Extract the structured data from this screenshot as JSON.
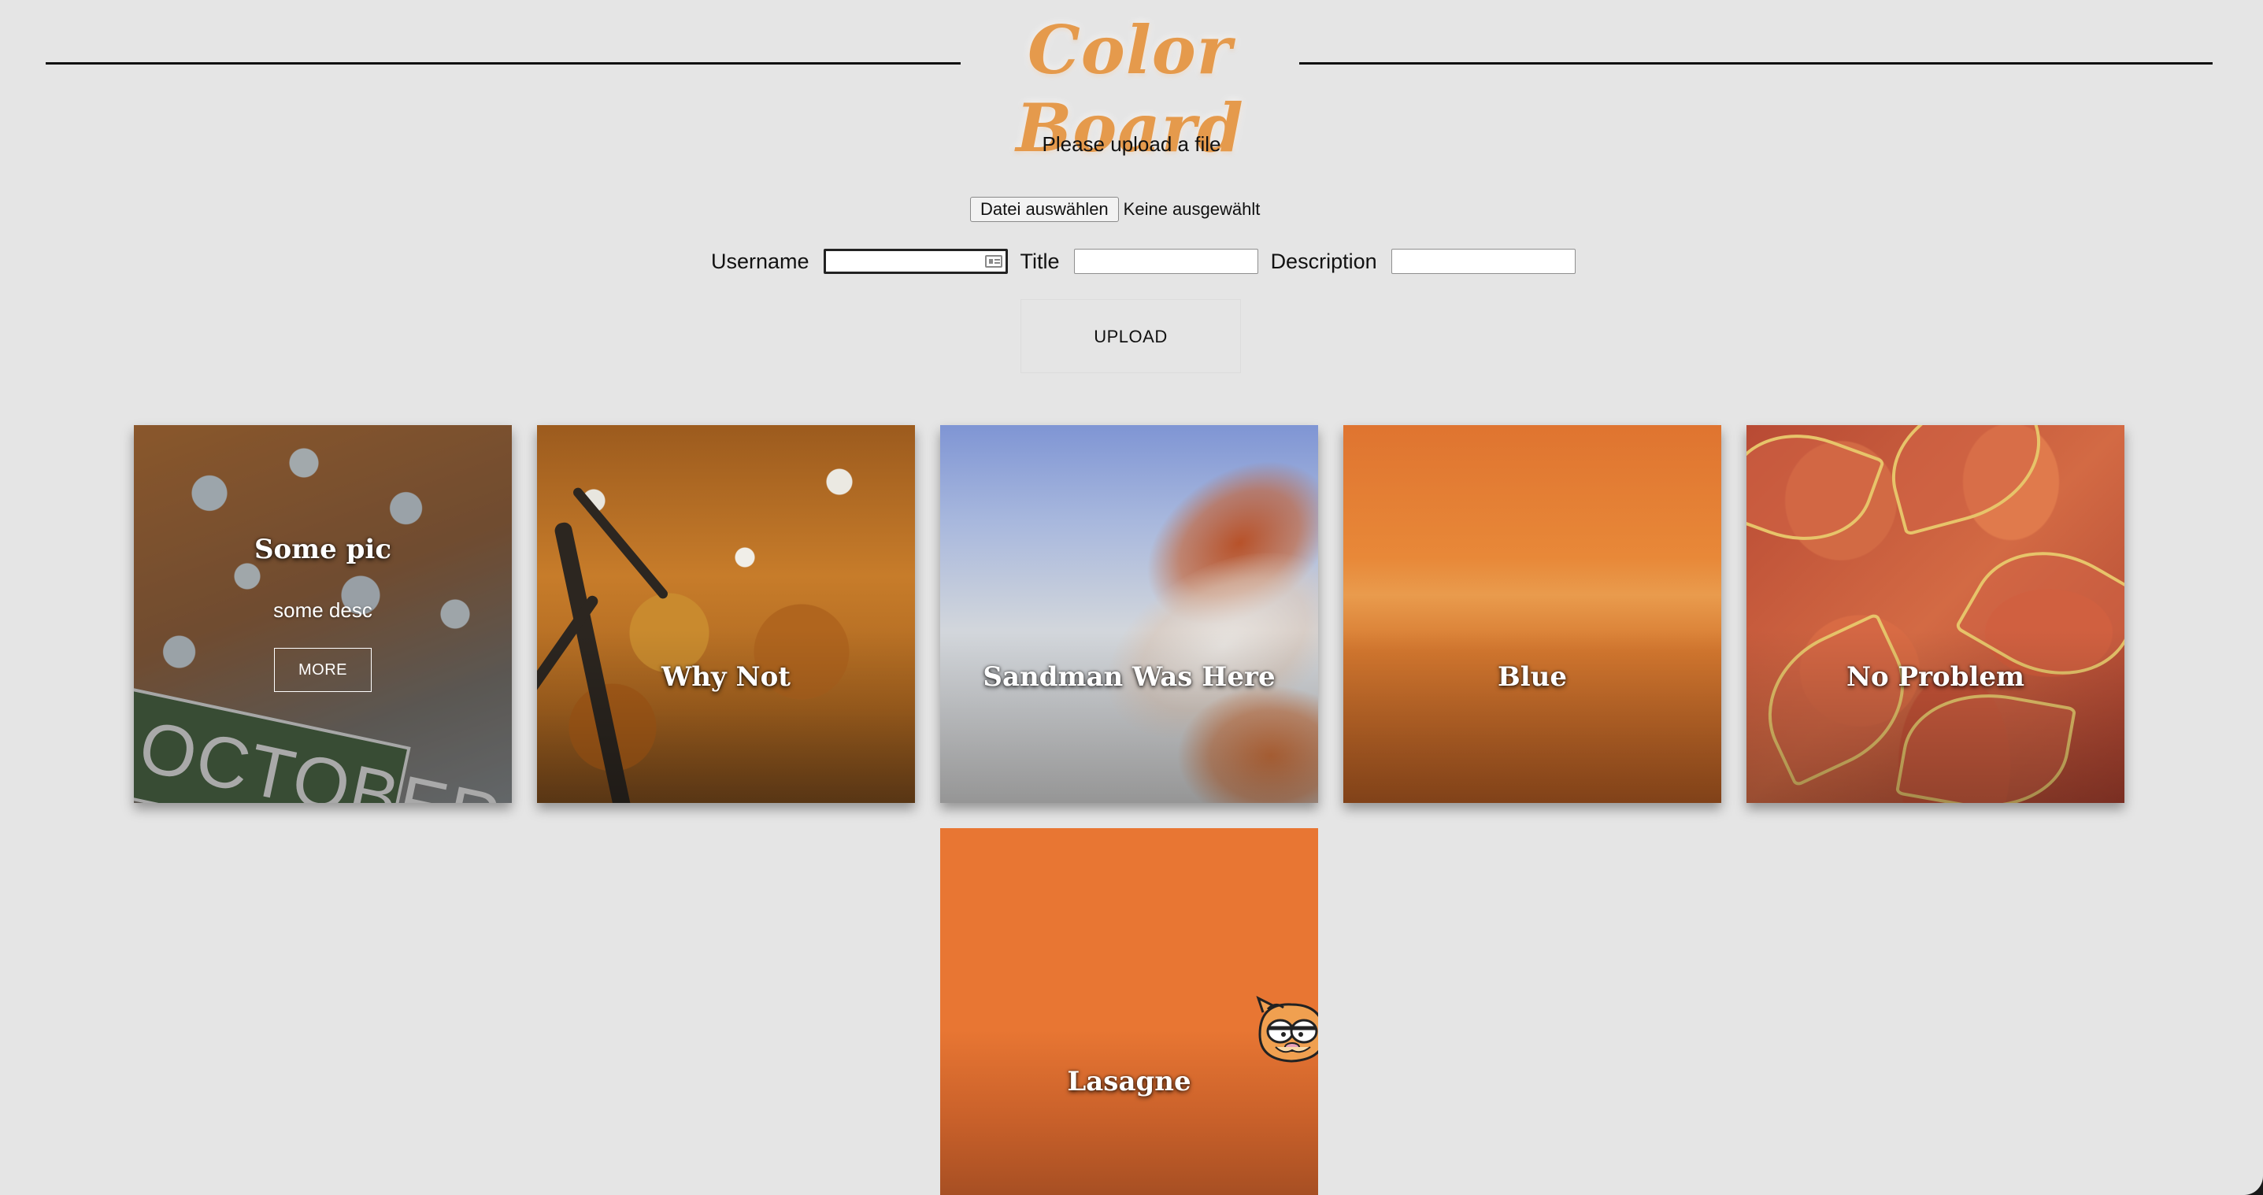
{
  "header": {
    "logo_text": "Color Board"
  },
  "upload_form": {
    "prompt": "Please upload a file",
    "file_button_label": "Datei auswählen",
    "file_status": "Keine ausgewählt",
    "username_label": "Username",
    "username_value": "",
    "title_label": "Title",
    "title_value": "",
    "description_label": "Description",
    "description_value": "",
    "upload_button_label": "UPLOAD"
  },
  "cards": [
    {
      "title": "Some pic",
      "description": "some desc",
      "more_label": "MORE",
      "sign_text": "OCTOBER"
    },
    {
      "title": "Why Not"
    },
    {
      "title": "Sandman Was Here"
    },
    {
      "title": "Blue"
    },
    {
      "title": "No Problem"
    },
    {
      "title": "Lasagne"
    }
  ],
  "colors": {
    "background": "#e5e5e5",
    "logo": "#e59a4c",
    "card_text": "#ffffff"
  }
}
